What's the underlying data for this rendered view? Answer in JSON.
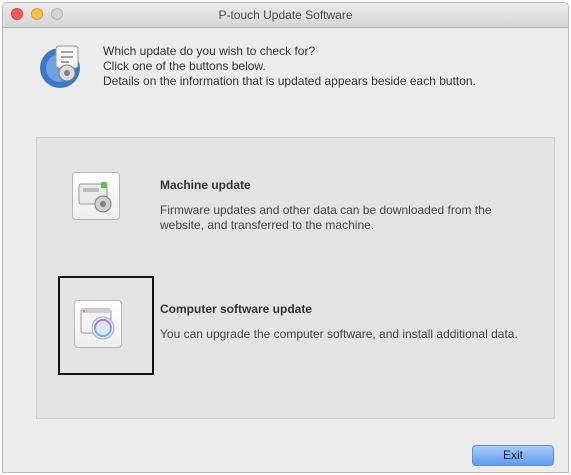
{
  "window": {
    "title": "P-touch Update Software"
  },
  "intro": {
    "line1": "Which update do you wish to check for?",
    "line2": "Click one of the buttons below.",
    "line3": "Details on the information that is updated appears beside each button."
  },
  "options": [
    {
      "title": "Machine update",
      "description": "Firmware updates and other data can be downloaded from the website, and transferred to the machine.",
      "icon": "machine-update-icon"
    },
    {
      "title": "Computer software update",
      "description": "You can upgrade the computer software, and install additional data.",
      "icon": "computer-software-update-icon"
    }
  ],
  "footer": {
    "exit_label": "Exit"
  },
  "colors": {
    "close": "#f35b54",
    "minimize": "#f6be4f",
    "accent_button": "#5b9cf0"
  }
}
